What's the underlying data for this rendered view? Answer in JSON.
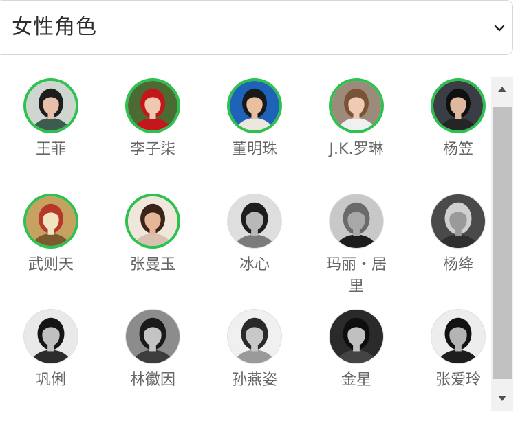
{
  "dropdown": {
    "selected": "女性角色",
    "icon": "chevron-down-icon"
  },
  "people": [
    {
      "name": "王菲",
      "selected": true,
      "bg": "#cfd6cf",
      "skin": "#e8c0a8",
      "hair": "#1d1d1d",
      "cloth": "#3e5b4f"
    },
    {
      "name": "李子柒",
      "selected": true,
      "bg": "#4c6b33",
      "skin": "#f0c8b0",
      "hair": "#c4171c",
      "cloth": "#c4171c"
    },
    {
      "name": "董明珠",
      "selected": true,
      "bg": "#1f63b8",
      "skin": "#e8c0a0",
      "hair": "#1a1a1a",
      "cloth": "#ece7dc"
    },
    {
      "name": "J.K.罗琳",
      "selected": true,
      "bg": "#9c8b7b",
      "skin": "#efcbb5",
      "hair": "#7b5236",
      "cloth": "#f0f0f0"
    },
    {
      "name": "杨笠",
      "selected": true,
      "bg": "#3a3d44",
      "skin": "#e0b8a0",
      "hair": "#101010",
      "cloth": "#252525"
    },
    {
      "name": "武则天",
      "selected": true,
      "bg": "#c7a15f",
      "skin": "#f1e2c0",
      "hair": "#b5382a",
      "cloth": "#7a5a2e"
    },
    {
      "name": "张曼玉",
      "selected": true,
      "bg": "#f0e6dc",
      "skin": "#e6b69b",
      "hair": "#3a2418",
      "cloth": "#d8c1b0"
    },
    {
      "name": "冰心",
      "selected": false,
      "bg": "#dedede",
      "skin": "#b8b8b8",
      "hair": "#1d1d1d",
      "cloth": "#7b7b7b"
    },
    {
      "name": "玛丽・居里",
      "selected": false,
      "bg": "#c8c8c8",
      "skin": "#a8a8a8",
      "hair": "#6a6a6a",
      "cloth": "#1c1c1c"
    },
    {
      "name": "杨绛",
      "selected": false,
      "bg": "#4a4a4a",
      "skin": "#9a9a9a",
      "hair": "#d0d0d0",
      "cloth": "#2f2f2f"
    },
    {
      "name": "巩俐",
      "selected": false,
      "bg": "#e9e9e9",
      "skin": "#c0c0c0",
      "hair": "#151515",
      "cloth": "#2c2c2c"
    },
    {
      "name": "林徽因",
      "selected": false,
      "bg": "#8c8c8c",
      "skin": "#c4c4c4",
      "hair": "#1a1a1a",
      "cloth": "#3c3c3c"
    },
    {
      "name": "孙燕姿",
      "selected": false,
      "bg": "#f0f0f0",
      "skin": "#c8c8c8",
      "hair": "#2a2a2a",
      "cloth": "#9a9a9a"
    },
    {
      "name": "金星",
      "selected": false,
      "bg": "#2a2a2a",
      "skin": "#c0c0c0",
      "hair": "#0e0e0e",
      "cloth": "#444444"
    },
    {
      "name": "张爱玲",
      "selected": false,
      "bg": "#ededed",
      "skin": "#b4b4b4",
      "hair": "#121212",
      "cloth": "#1e1e1e"
    }
  ],
  "colors": {
    "selected_ring": "#2dc24f",
    "name_text": "#666666",
    "scrollbar_track": "#f1f1f1",
    "scrollbar_thumb": "#c1c1c1"
  },
  "scrollbar": {
    "up_icon": "arrow-up-icon",
    "down_icon": "arrow-down-icon"
  }
}
